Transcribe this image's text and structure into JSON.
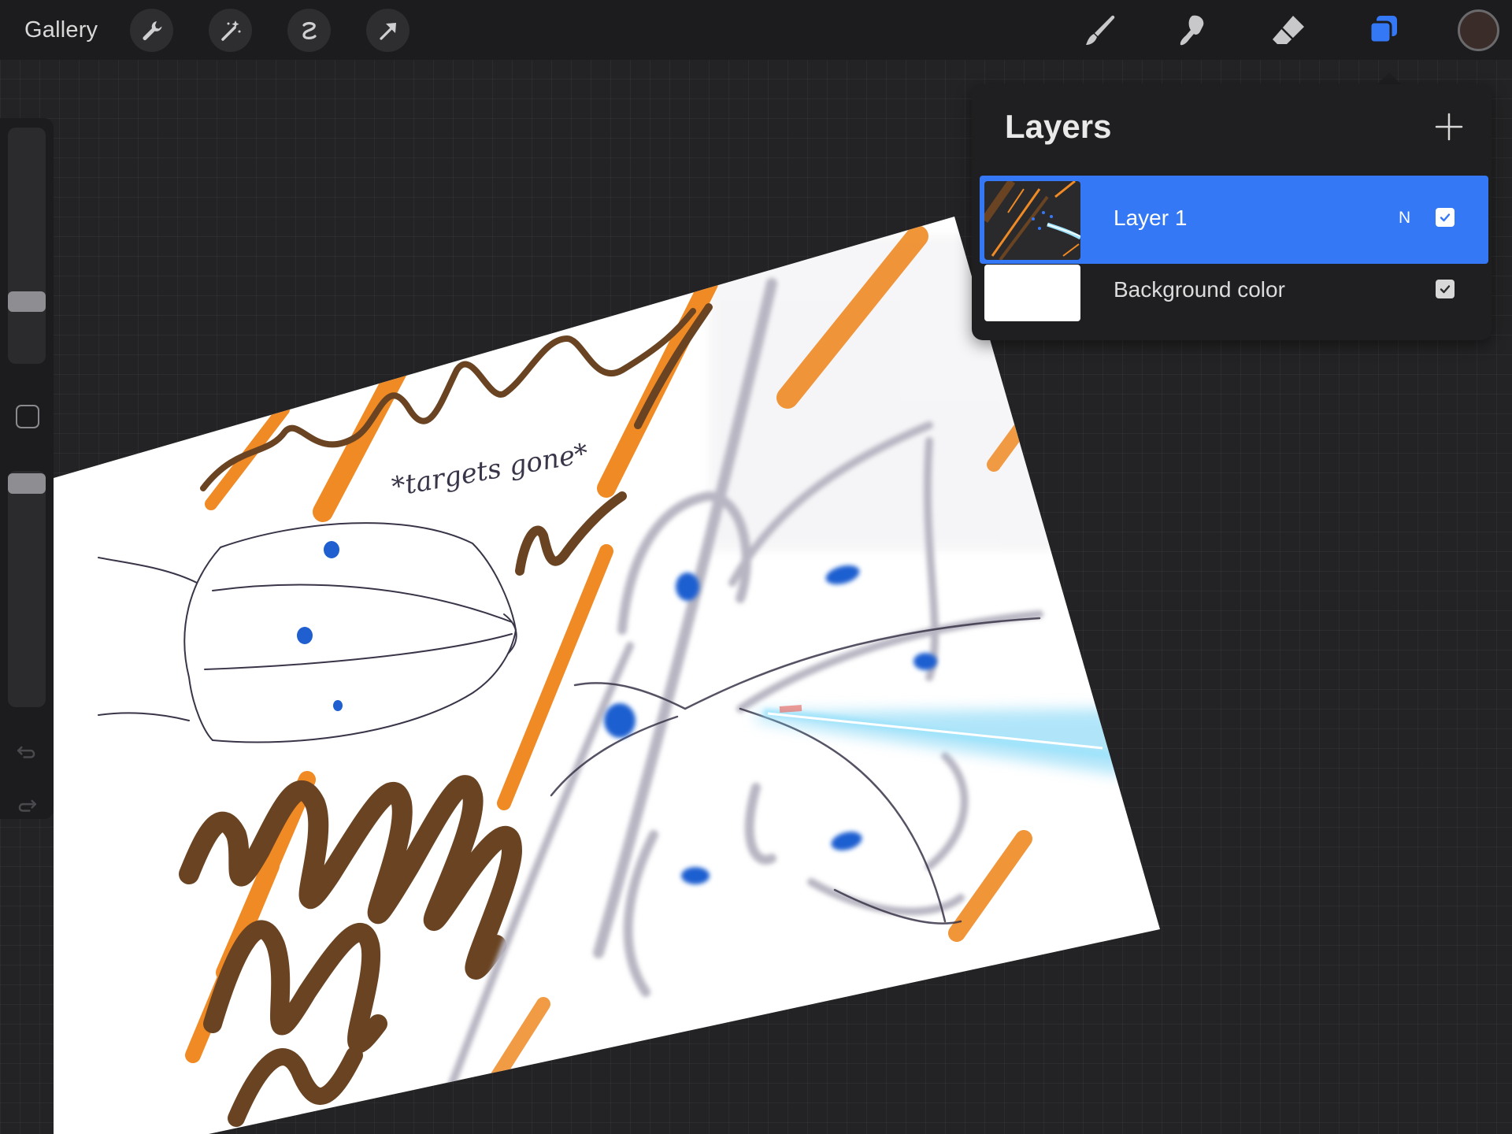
{
  "toolbar": {
    "gallery_label": "Gallery",
    "left_tools": [
      "wrench-icon",
      "magic-wand-icon",
      "selection-icon",
      "transform-arrow-icon"
    ],
    "right_tools": [
      "brush-icon",
      "smudge-icon",
      "eraser-icon",
      "layers-icon"
    ],
    "active_tool": "layers-icon",
    "accent_color": "#3478f6",
    "current_color": "#3a2c28"
  },
  "sidebar": {
    "brush_size_level": 0.28,
    "opacity_level": 0.0,
    "items": [
      "brush-size-slider",
      "modify-button",
      "opacity-slider",
      "undo-icon",
      "redo-icon"
    ]
  },
  "canvas": {
    "annotation_text": "*targets gone*",
    "colors": {
      "orange": "#f08a24",
      "brown": "#6a4422",
      "blue": "#1f5fd0",
      "beam": "#6fd0f5",
      "pencil": "#2f2b3a"
    }
  },
  "layers_panel": {
    "title": "Layers",
    "add_label": "+",
    "layers": [
      {
        "name": "Layer 1",
        "blend_mode": "N",
        "visible": true,
        "selected": true
      },
      {
        "name": "Background color",
        "visible": true,
        "selected": false
      }
    ]
  }
}
